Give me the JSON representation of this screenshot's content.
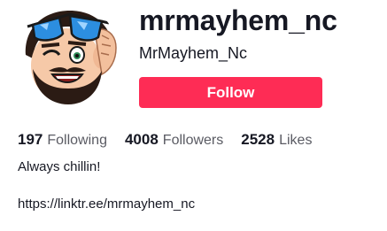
{
  "profile": {
    "username": "mrmayhem_nc",
    "nickname": "MrMayhem_Nc",
    "follow_label": "Follow",
    "bio": "Always chillin!",
    "link": "https://linktr.ee/mrmayhem_nc",
    "avatar_icon": "cartoon-avatar-with-blue-sunglasses",
    "accent_color": "#fe2c55"
  },
  "stats": [
    {
      "count": "197",
      "label": "Following"
    },
    {
      "count": "4008",
      "label": "Followers"
    },
    {
      "count": "2528",
      "label": "Likes"
    }
  ]
}
